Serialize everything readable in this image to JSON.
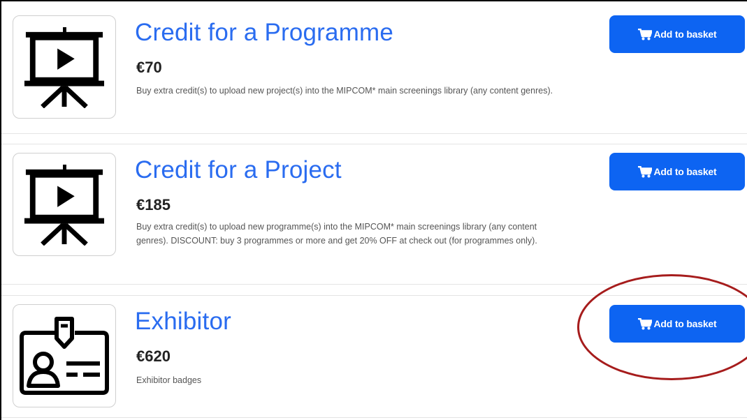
{
  "products": [
    {
      "icon": "presentation-screen-icon",
      "title": "Credit for a Programme",
      "price": "€70",
      "description": "Buy extra credit(s) to upload new project(s) into the MIPCOM* main screenings library (any content genres).",
      "button_label": "Add to basket"
    },
    {
      "icon": "presentation-screen-icon",
      "title": "Credit for a Project",
      "price": "€185",
      "description": "Buy extra credit(s) to upload new programme(s) into the MIPCOM* main screenings library (any content genres). DISCOUNT: buy 3 programmes or more and get 20% OFF at check out (for programmes only).",
      "button_label": "Add to basket"
    },
    {
      "icon": "id-badge-icon",
      "title": "Exhibitor",
      "price": "€620",
      "description": "Exhibitor badges",
      "button_label": "Add to basket"
    }
  ],
  "colors": {
    "title": "#2a6cf0",
    "button": "#0d64f2",
    "highlight_ring": "#a61c1c"
  }
}
